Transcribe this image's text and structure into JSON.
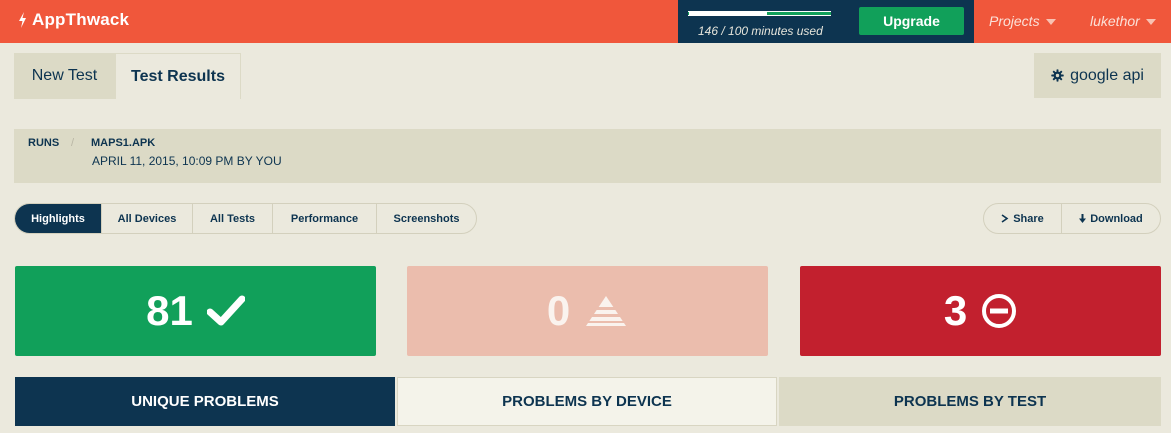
{
  "header": {
    "app_name": "AppThwack",
    "usage_text": "146 / 100 minutes used",
    "usage_fraction": 0.55,
    "upgrade_label": "Upgrade",
    "projects_label": "Projects",
    "user_label": "lukethor"
  },
  "tabs": {
    "new_test": "New Test",
    "test_results": "Test Results",
    "project_name": "google api"
  },
  "breadcrumb": {
    "runs": "RUNS",
    "separator": "/",
    "file": "MAPS1.APK",
    "meta": "APRIL 11, 2015, 10:09 PM BY YOU"
  },
  "subnav": [
    {
      "label": "Highlights",
      "active": true
    },
    {
      "label": "All Devices",
      "active": false
    },
    {
      "label": "All Tests",
      "active": false
    },
    {
      "label": "Performance",
      "active": false
    },
    {
      "label": "Screenshots",
      "active": false
    }
  ],
  "actions": {
    "share": "Share",
    "download": "Download"
  },
  "summary": {
    "passed": "81",
    "warnings": "0",
    "failed": "3"
  },
  "problem_tabs": {
    "unique": "UNIQUE PROBLEMS",
    "by_device": "PROBLEMS BY DEVICE",
    "by_test": "PROBLEMS BY TEST"
  },
  "colors": {
    "brand": "#f0573b",
    "navy": "#0d3450",
    "pass": "#11a05a",
    "warn": "#ebbdad",
    "fail": "#c2202e",
    "background": "#ebe9dd",
    "panel": "#dcdac6"
  },
  "icons": {
    "logo": "bolt-icon",
    "project": "gear-icon",
    "share": "chevron-right-icon",
    "download": "download-arrow-icon",
    "passed": "checkmark-icon",
    "warnings": "warning-triangle-icon",
    "failed": "minus-circle-icon"
  }
}
